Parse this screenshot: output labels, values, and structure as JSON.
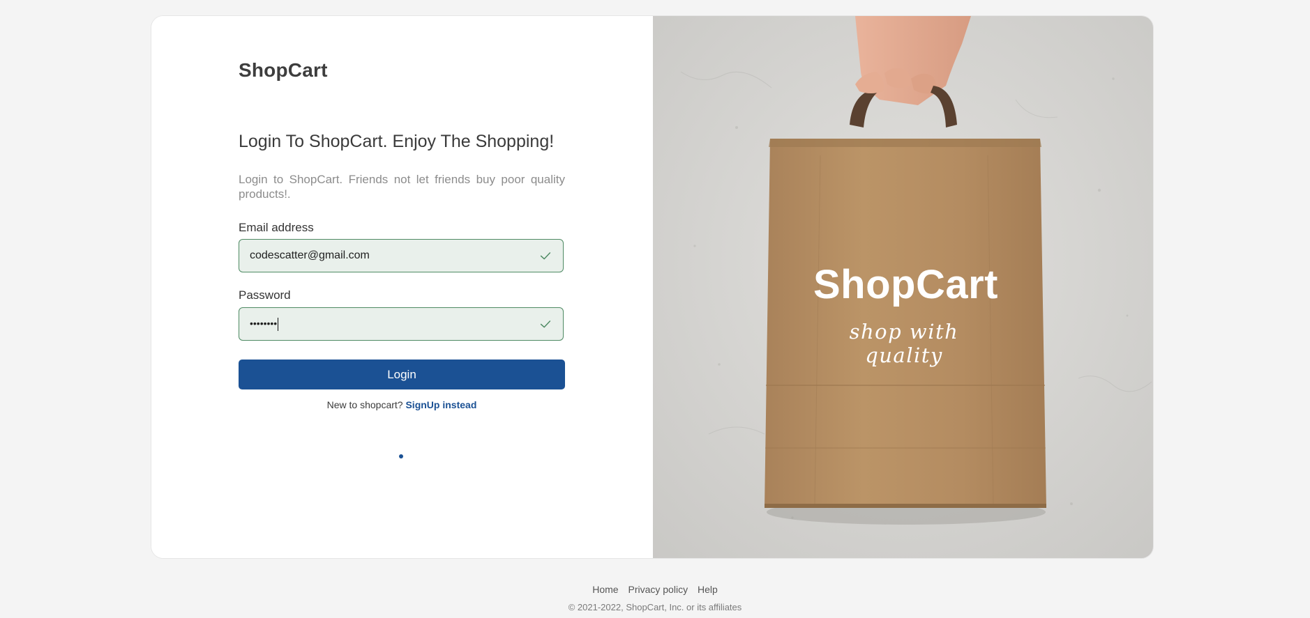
{
  "brand": "ShopCart",
  "form": {
    "heading": "Login To ShopCart. Enjoy The Shopping!",
    "subtext": "Login to ShopCart. Friends not let friends buy poor quality products!.",
    "email_label": "Email address",
    "email_value": "codescatter@gmail.com",
    "password_label": "Password",
    "password_value": "••••••••",
    "login_label": "Login",
    "signup_prompt": "New to shopcart?",
    "signup_link": "SignUp instead"
  },
  "hero": {
    "bag_title": "ShopCart",
    "bag_tagline": "shop with quality"
  },
  "footer": {
    "links": [
      "Home",
      "Privacy policy",
      "Help"
    ],
    "copyright": "© 2021-2022, ShopCart, Inc. or its affiliates"
  },
  "colors": {
    "accent": "#1b5194",
    "valid_border": "#4e8a63",
    "valid_fill": "#e9f0eb",
    "bag": "#b38d60"
  },
  "icons": [
    "checkmark-icon"
  ]
}
